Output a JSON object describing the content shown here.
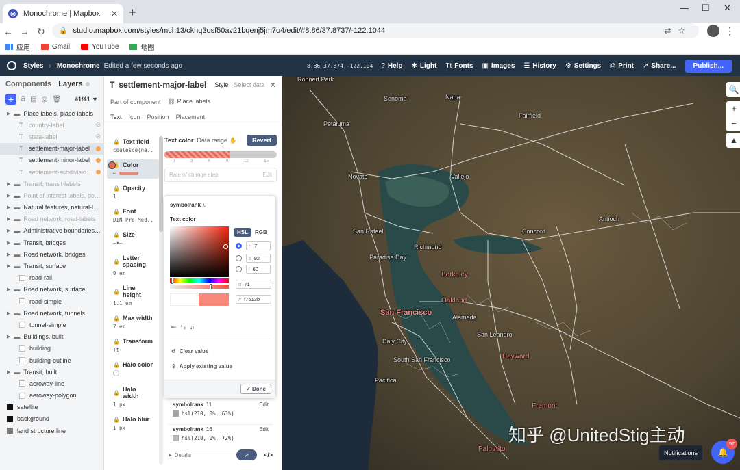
{
  "browser": {
    "tab_title": "Monochrome | Mapbox",
    "url": "studio.mapbox.com/styles/mch13/ckhq3osf50av21bqenj5jm7o4/edit/#8.86/37.8737/-122.1044",
    "bookmarks": [
      {
        "label": "应用",
        "icon": "apps-grid-icon"
      },
      {
        "label": "Gmail",
        "icon": "gmail-icon"
      },
      {
        "label": "YouTube",
        "icon": "youtube-icon"
      },
      {
        "label": "地图",
        "icon": "maps-icon"
      }
    ]
  },
  "topbar": {
    "styles": "Styles",
    "style_name": "Monochrome",
    "status": "Edited a few seconds ago",
    "coords": "8.86 37.874,-122.104",
    "items": [
      "Help",
      "Light",
      "Fonts",
      "Images",
      "History",
      "Settings",
      "Print",
      "Share..."
    ],
    "publish": "Publish..."
  },
  "left": {
    "tab_components": "Components",
    "tab_layers": "Layers",
    "count": "41/41",
    "rows": [
      {
        "label": "Place labels, place-labels",
        "kind": "group"
      },
      {
        "label": "country-label",
        "kind": "child",
        "dim": true
      },
      {
        "label": "state-label",
        "kind": "child",
        "dim": true
      },
      {
        "label": "settlement-major-label",
        "kind": "child",
        "selected": true
      },
      {
        "label": "settlement-minor-label",
        "kind": "child"
      },
      {
        "label": "settlement-subdivision-label",
        "kind": "child",
        "dim": true
      },
      {
        "label": "Transit, transit-labels",
        "kind": "group",
        "dim": true
      },
      {
        "label": "Point of interest labels, poi-labels",
        "kind": "group",
        "dim": true
      },
      {
        "label": "Natural features, natural-labels",
        "kind": "group"
      },
      {
        "label": "Road network, road-labels",
        "kind": "group",
        "dim": true
      },
      {
        "label": "Administrative boundaries, admin",
        "kind": "group"
      },
      {
        "label": "Transit, bridges",
        "kind": "group"
      },
      {
        "label": "Road network, bridges",
        "kind": "group"
      },
      {
        "label": "Transit, surface",
        "kind": "group"
      },
      {
        "label": "road-rail",
        "kind": "child"
      },
      {
        "label": "Road network, surface",
        "kind": "group"
      },
      {
        "label": "road-simple",
        "kind": "child"
      },
      {
        "label": "Road network, tunnels",
        "kind": "group"
      },
      {
        "label": "tunnel-simple",
        "kind": "child"
      },
      {
        "label": "Buildings, built",
        "kind": "group"
      },
      {
        "label": "building",
        "kind": "child"
      },
      {
        "label": "building-outline",
        "kind": "child"
      },
      {
        "label": "Transit, built",
        "kind": "group"
      },
      {
        "label": "aeroway-line",
        "kind": "child"
      },
      {
        "label": "aeroway-polygon",
        "kind": "child"
      },
      {
        "label": "satellite",
        "kind": "root"
      },
      {
        "label": "background",
        "kind": "root"
      },
      {
        "label": "land structure line",
        "kind": "root"
      }
    ]
  },
  "props": {
    "layer_name": "settlement-major-label",
    "tab_style": "Style",
    "tab_select": "Select data",
    "part_of": "Part of component",
    "component": "Place labels",
    "subtabs": [
      "Text",
      "Icon",
      "Position",
      "Placement"
    ],
    "list": [
      {
        "name": "Text field",
        "value": "coalesce(na..."
      },
      {
        "name": "Color",
        "value": ""
      },
      {
        "name": "Opacity",
        "value": "1"
      },
      {
        "name": "Font",
        "value": "DIN Pro Med..."
      },
      {
        "name": "Size",
        "value": ""
      },
      {
        "name": "Letter spacing",
        "value": "0 em"
      },
      {
        "name": "Line height",
        "value": "1.1 em"
      },
      {
        "name": "Max width",
        "value": "7 em"
      },
      {
        "name": "Transform",
        "value": "Tt"
      },
      {
        "name": "Halo color",
        "value": ""
      },
      {
        "name": "Halo width",
        "value": "1 px"
      },
      {
        "name": "Halo blur",
        "value": "1 px"
      }
    ],
    "editor": {
      "title": "Text color",
      "data_range": "Data range",
      "revert": "Revert",
      "ticks": [
        "0",
        "3",
        "6",
        "9",
        "12",
        "15"
      ],
      "rate": "Rate of change step",
      "rate_edit": "Edit"
    },
    "popover": {
      "title": "symbolrank",
      "title_value": "0",
      "subtitle": "Text color",
      "mode_hsl": "HSL",
      "mode_rgb": "RGB",
      "h": "7",
      "s": "92",
      "l": "60",
      "alpha": "71",
      "hex": "f7513b",
      "clear": "Clear value",
      "apply": "Apply existing value",
      "done": "Done"
    },
    "stops": [
      {
        "name": "symbolrank",
        "zoom": "11",
        "value": "hsl(210, 0%, 63%)",
        "edit": "Edit",
        "color": "#a1a1a1"
      },
      {
        "name": "symbolrank",
        "zoom": "16",
        "value": "hsl(210, 0%, 72%)",
        "edit": "Edit",
        "color": "#b8b8b8"
      }
    ],
    "details": "Details"
  },
  "map": {
    "cities": [
      {
        "name": "Rohnert Park",
        "pink": false
      },
      {
        "name": "Sonoma",
        "pink": false
      },
      {
        "name": "Napa",
        "pink": false
      },
      {
        "name": "Petaluma",
        "pink": false
      },
      {
        "name": "Fairfield",
        "pink": false
      },
      {
        "name": "Novato",
        "pink": false
      },
      {
        "name": "Vallejo",
        "pink": false
      },
      {
        "name": "Antioch",
        "pink": false
      },
      {
        "name": "San Rafael",
        "pink": false
      },
      {
        "name": "Richmond",
        "pink": false
      },
      {
        "name": "Concord",
        "pink": false
      },
      {
        "name": "Paradise Day",
        "pink": false
      },
      {
        "name": "Berkeley",
        "pink": true
      },
      {
        "name": "Oakland",
        "pink": true
      },
      {
        "name": "San Francisco",
        "pink": true
      },
      {
        "name": "Alameda",
        "pink": false
      },
      {
        "name": "San Leandro",
        "pink": false
      },
      {
        "name": "Daly City",
        "pink": false
      },
      {
        "name": "Hayward",
        "pink": true
      },
      {
        "name": "South San Francisco",
        "pink": false
      },
      {
        "name": "Pacifica",
        "pink": false
      },
      {
        "name": "Fremont",
        "pink": true
      },
      {
        "name": "Palo Alto",
        "pink": true
      }
    ],
    "watermark": "知乎 @UnitedStig主动",
    "notifications": "Notifications",
    "badge": "57"
  }
}
